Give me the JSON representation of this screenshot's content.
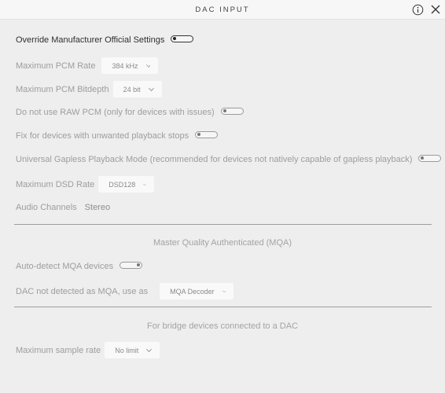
{
  "window": {
    "title": "DAC INPUT"
  },
  "override": {
    "label": "Override Manufacturer Official Settings"
  },
  "max_pcm_rate": {
    "label": "Maximum PCM Rate",
    "value": "384 kHz"
  },
  "max_pcm_bitdepth": {
    "label": "Maximum PCM Bitdepth",
    "value": "24 bit"
  },
  "no_raw_pcm": {
    "label": "Do not use RAW PCM (only for devices with issues)"
  },
  "fix_stops": {
    "label": "Fix for devices with unwanted playback stops"
  },
  "gapless": {
    "label": "Universal Gapless Playback Mode (recommended for devices not natively capable of gapless playback)"
  },
  "max_dsd_rate": {
    "label": "Maximum DSD Rate",
    "value": "DSD128"
  },
  "audio_channels": {
    "label": "Audio Channels",
    "value": "Stereo"
  },
  "mqa": {
    "section_title": "Master Quality Authenticated (MQA)",
    "autodetect_label": "Auto-detect MQA devices",
    "not_detected_label": "DAC not detected as MQA, use as",
    "not_detected_value": "MQA Decoder"
  },
  "bridge": {
    "section_title": "For bridge devices connected to a DAC",
    "max_sample_label": "Maximum sample rate",
    "max_sample_value": "No limit"
  }
}
